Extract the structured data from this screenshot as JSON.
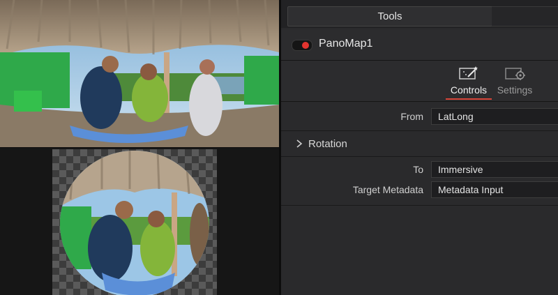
{
  "panel": {
    "tab_title": "Tools",
    "node": {
      "name": "PanoMap1",
      "enabled": true,
      "toggle_color": "#e3342f"
    },
    "subtabs": [
      {
        "label": "Controls",
        "icon": "controls-wand-icon",
        "active": true
      },
      {
        "label": "Settings",
        "icon": "settings-gear-icon",
        "active": false
      }
    ],
    "fields": {
      "from": {
        "label": "From",
        "value": "LatLong"
      },
      "to": {
        "label": "To",
        "value": "Immersive"
      },
      "target_metadata": {
        "label": "Target Metadata",
        "value": "Metadata Input"
      }
    },
    "sections": [
      {
        "label": "Rotation",
        "expanded": false
      }
    ]
  },
  "colors": {
    "accent": "#d9463a",
    "panel_bg": "#2a2a2c",
    "viewer_bg": "#161616"
  },
  "viewers": [
    {
      "name": "equirectangular-viewer",
      "content": "photo"
    },
    {
      "name": "immersive-fisheye-viewer",
      "content": "photo"
    }
  ]
}
